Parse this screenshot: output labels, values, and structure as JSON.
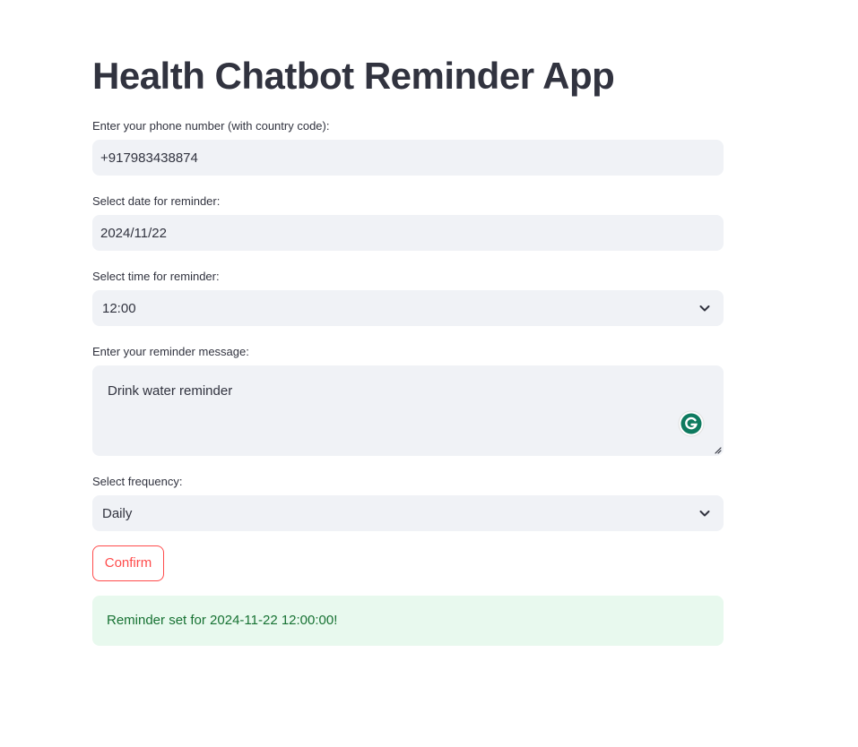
{
  "app": {
    "title": "Health Chatbot Reminder App"
  },
  "phone": {
    "label": "Enter your phone number (with country code):",
    "value": "+917983438874"
  },
  "date": {
    "label": "Select date for reminder:",
    "value": "2024/11/22"
  },
  "time": {
    "label": "Select time for reminder:",
    "value": "12:00"
  },
  "message": {
    "label": "Enter your reminder message:",
    "value": "Drink water reminder"
  },
  "frequency": {
    "label": "Select frequency:",
    "value": "Daily"
  },
  "confirm": {
    "label": "Confirm"
  },
  "alert": {
    "text": "Reminder set for 2024-11-22 12:00:00!"
  },
  "colors": {
    "accent": "#ff4b4b",
    "field_bg": "#f0f2f6",
    "success_bg": "#e8f9ee",
    "success_text": "#177233",
    "grammarly": "#15c39a"
  },
  "icons": {
    "time_chevron": "chevron-down-icon",
    "frequency_chevron": "chevron-down-icon",
    "grammarly": "grammarly-icon",
    "resize": "resize-handle-icon"
  }
}
